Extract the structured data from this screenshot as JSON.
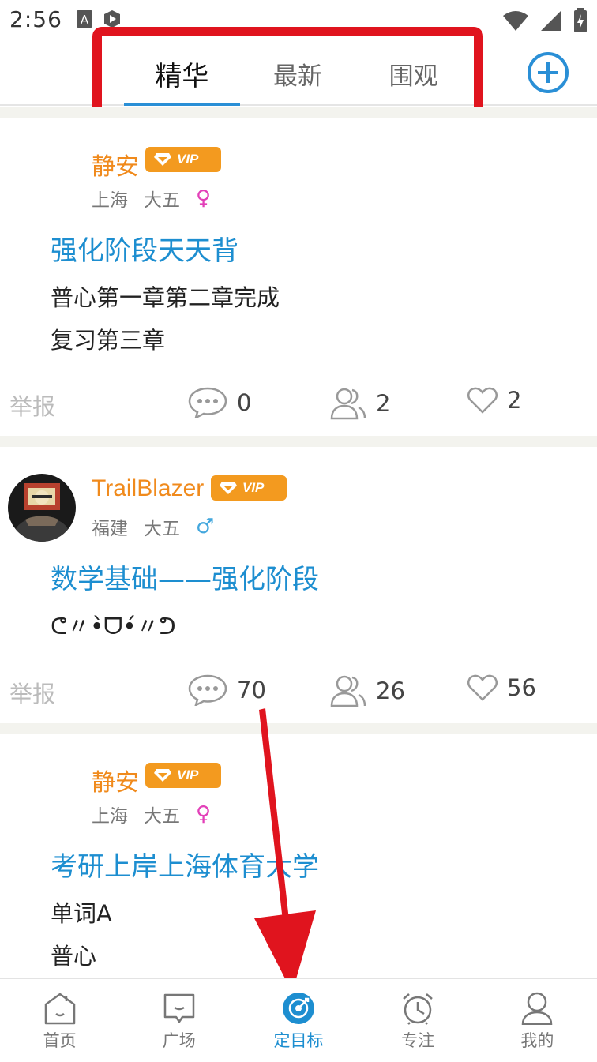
{
  "status_bar": {
    "time": "2:56"
  },
  "header": {
    "tabs": [
      {
        "label": "精华",
        "active": true
      },
      {
        "label": "最新",
        "active": false
      },
      {
        "label": "围观",
        "active": false
      }
    ],
    "add_icon": "plus-circle-icon",
    "accent_color": "#2a8fd6",
    "annotation_color": "#e0141e"
  },
  "posts": [
    {
      "username": "静安",
      "vip_label": "VIP",
      "location": "上海",
      "grade": "大五",
      "gender": "♀",
      "title": "强化阶段天天背",
      "body": [
        "普心第一章第二章完成",
        "复习第三章"
      ],
      "report_label": "举报",
      "comments": "0",
      "participants": "2",
      "likes": "2"
    },
    {
      "username": "TrailBlazer",
      "vip_label": "VIP",
      "location": "福建",
      "grade": "大五",
      "gender": "♂",
      "title": "数学基础——强化阶段",
      "body": [
        "ᕦ〃•̀ᗜ•́〃ᕤ"
      ],
      "report_label": "举报",
      "comments": "70",
      "participants": "26",
      "likes": "56"
    },
    {
      "username": "静安",
      "vip_label": "VIP",
      "location": "上海",
      "grade": "大五",
      "gender": "♀",
      "title": "考研上岸上海体育大学",
      "body": [
        "单词A",
        "普心"
      ]
    }
  ],
  "tabbar": {
    "items": [
      {
        "label": "首页",
        "icon": "home-icon"
      },
      {
        "label": "广场",
        "icon": "square-chat-icon"
      },
      {
        "label": "定目标",
        "icon": "target-icon",
        "active": true
      },
      {
        "label": "专注",
        "icon": "alarm-clock-icon"
      },
      {
        "label": "我的",
        "icon": "person-icon"
      }
    ]
  }
}
